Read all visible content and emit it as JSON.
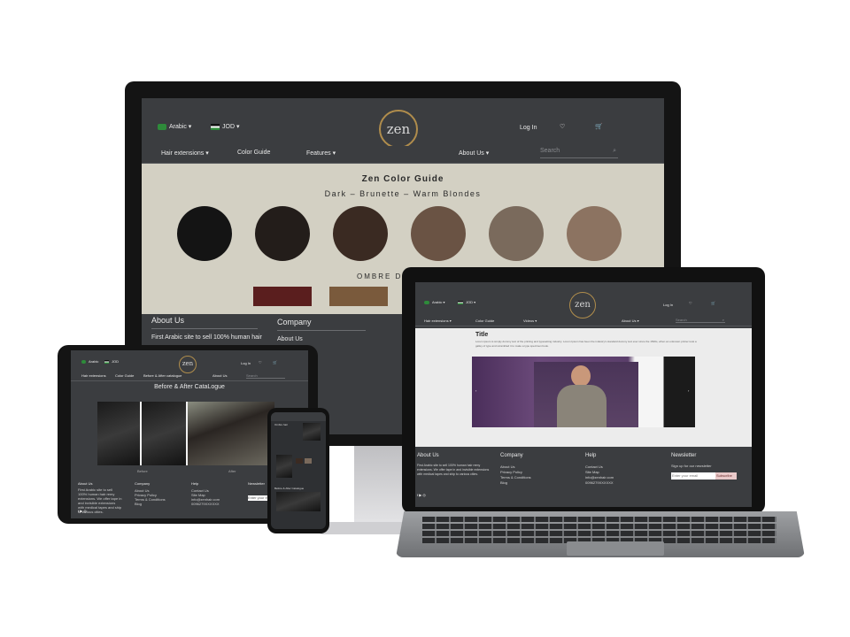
{
  "desktop": {
    "header": {
      "lang": "Arabic",
      "currency": "JOD",
      "logo": "zen",
      "login": "Log In"
    },
    "nav": [
      "Hair extensions",
      "Color Guide",
      "Features",
      "About Us"
    ],
    "search_placeholder": "Search",
    "hero": {
      "title": "Zen Color Guide",
      "subtitle": "Dark – Brunette – Warm Blondes",
      "swatch_colors": [
        "#141414",
        "#231d1a",
        "#3a2a22",
        "#6a5344",
        "#7a6a5c",
        "#8c7361"
      ],
      "ombre_label": "OMBRE D",
      "ombre_colors": [
        "#5a1e1e",
        "#7a5a3c"
      ]
    },
    "footer": {
      "about_title": "About Us",
      "about_text": "First Arabic site to sell 100% human hair",
      "company_title": "Company",
      "company_link": "About Us"
    }
  },
  "laptop": {
    "header": {
      "lang": "Arabic",
      "currency": "JOD",
      "logo": "zen",
      "login": "Log In"
    },
    "nav": [
      "Hair extensions",
      "Color Guide",
      "Videos",
      "About Us"
    ],
    "search_placeholder": "Search",
    "page_title": "Title",
    "body_text": "Lorem ipsum is simply dummy text of the printing and typesetting industry. Lorem Ipsum has been the industry's standard dummy text ever since the 1500s, when an unknown printer took a galley of type and scrambled it to make a type specimen book.",
    "footer": {
      "about_title": "About Us",
      "about_text": "First Arabic site to sell 100% human hair remy extensions. We offer tape in and invisible extensions with medical tapes and ship to various cities.",
      "company_title": "Company",
      "company_links": [
        "About Us",
        "Privacy Policy",
        "Terms & Conditions",
        "Blog"
      ],
      "help_title": "Help",
      "help_links": [
        "Contact Us",
        "Site Map",
        "info@zenhair.com",
        "0096279XXXXXX"
      ],
      "newsletter_title": "Newsletter",
      "newsletter_text": "Sign up for our newsletter",
      "email_placeholder": "Enter your email",
      "subscribe": "Subscribe"
    }
  },
  "tablet": {
    "header": {
      "lang": "Arabic",
      "currency": "JOD",
      "logo": "zen",
      "login": "Log In"
    },
    "nav": [
      "Hair extensions",
      "Color Guide",
      "Before & After catalogue",
      "About Us"
    ],
    "search_placeholder": "Search",
    "section_title": "Before & After CataLogue",
    "caption_before": "Before",
    "caption_after": "After",
    "footer": {
      "about_title": "About Us",
      "about_text": "First Arabic site to sell 100% human hair remy extensions. We offer tape in and invisible extensions with medical tapes and ship to various cities.",
      "company_title": "Company",
      "company_links": [
        "About Us",
        "Privacy Policy",
        "Terms & Conditions",
        "Blog"
      ],
      "help_title": "Help",
      "help_links": [
        "Contact Us",
        "Site Map",
        "info@zenhair.com",
        "0096279XXXXXX"
      ],
      "newsletter_title": "Newsletter",
      "email_placeholder": "Enter your email"
    }
  },
  "phone": {
    "label_1": "Ombre hair",
    "label_2": "Before & After Catalogue"
  }
}
